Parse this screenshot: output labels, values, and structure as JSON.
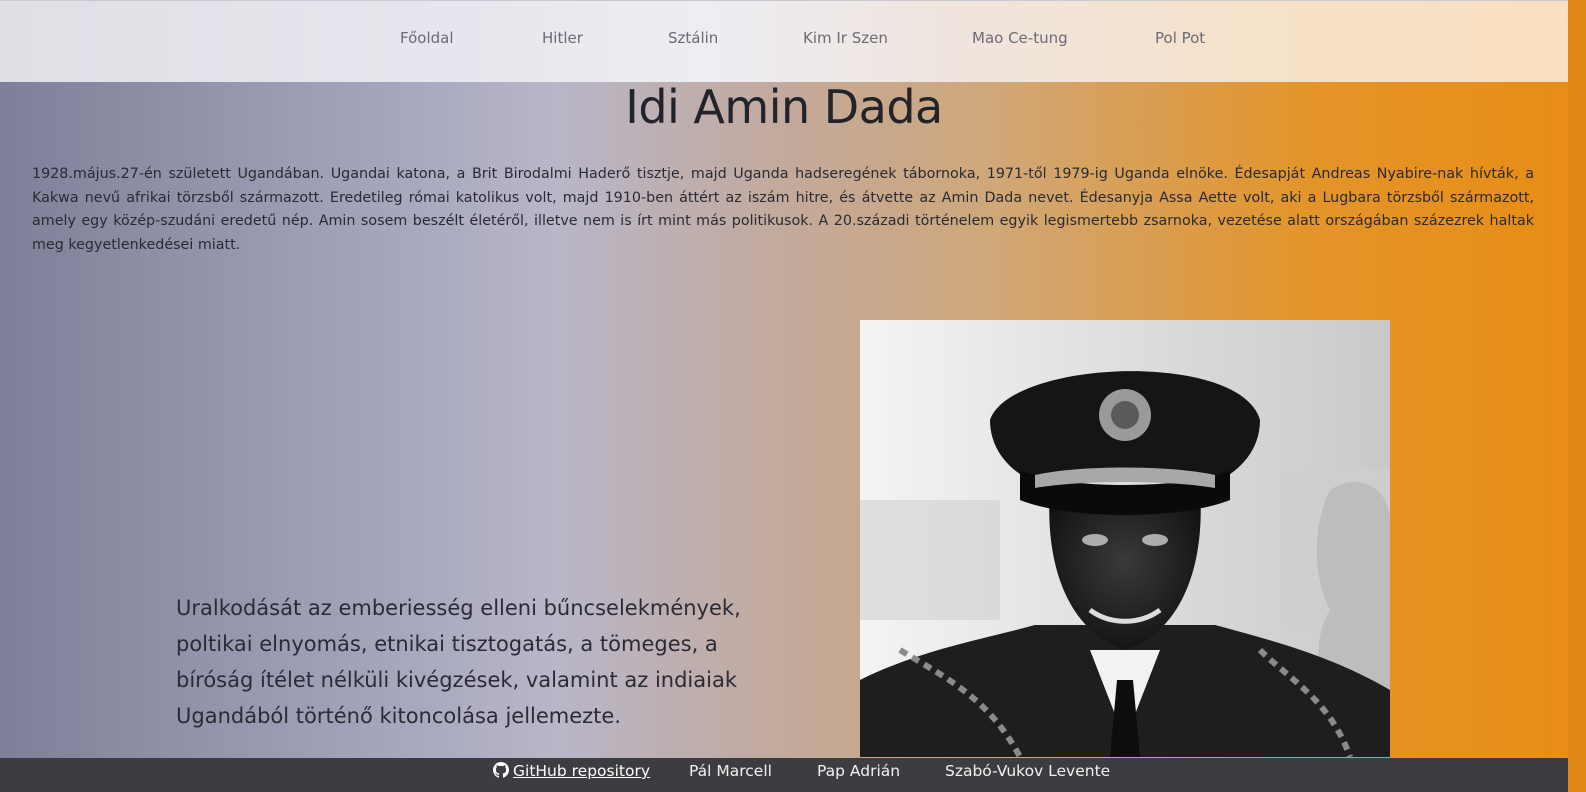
{
  "nav": {
    "items": [
      {
        "label": "Főoldal"
      },
      {
        "label": "Hitler"
      },
      {
        "label": "Sztálin"
      },
      {
        "label": "Kim Ir Szen"
      },
      {
        "label": "Mao Ce-tung"
      },
      {
        "label": "Pol Pot"
      }
    ]
  },
  "page": {
    "title": "Idi Amin Dada",
    "intro": "1928.május.27-én született Ugandában. Ugandai katona, a Brit Birodalmi Haderő tisztje, majd Uganda hadseregének tábornoka, 1971-től 1979-ig Uganda elnöke. Édesapját Andreas Nyabire-nak hívták, a Kakwa nevű afrikai törzsből származott. Eredetileg római katolikus volt, majd 1910-ben áttért az iszám hitre, és átvette az Amin Dada nevet. Édesanyja Assa Aette volt, aki a Lugbara törzsből származott, amely egy közép-szudáni eredetű nép. Amin sosem beszélt életéről, illetve nem is írt mint más politikusok. A 20.századi történelem egyik legismertebb zsarnoka, vezetése alatt országában százezrek haltak meg kegyetlenkedései miatt.",
    "quote": "Uralkodását az emberiesség elleni bűncselekmények, poltikai elnyomás, etnikai tisztogatás, a tömeges, a bíróság ítélet nélküli kivégzések, valamint az indiaiak Ugandából történő kitoncolása jellemezte."
  },
  "footer": {
    "github_label": "GitHub repository",
    "github_icon": "github-icon",
    "authors": [
      "Pál Marcell",
      "Pap Adrián",
      "Szabó-Vukov Levente"
    ]
  },
  "colors": {
    "footer_bg": "#3c3d40",
    "accent_orange": "#e88c14"
  }
}
